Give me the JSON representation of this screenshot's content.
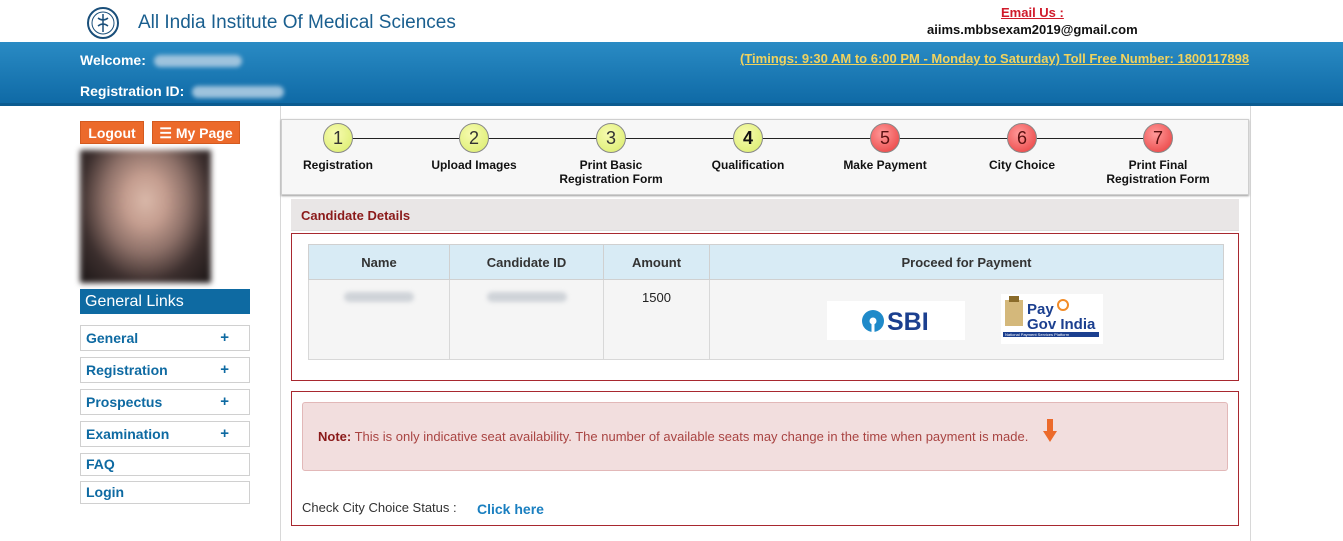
{
  "header": {
    "title": "All India Institute Of Medical Sciences",
    "email_label": "Email Us :",
    "email_value": "aiims.mbbsexam2019@gmail.com",
    "welcome_label": "Welcome:",
    "registration_label": "Registration ID:",
    "timings": "(Timings: 9:30 AM to 6:00 PM - Monday to Saturday) Toll Free Number: 1800117898"
  },
  "sidebar": {
    "logout_label": "Logout",
    "mypage_label": "My Page",
    "general_links_title": "General Links",
    "items": [
      {
        "label": "General",
        "expand": "+"
      },
      {
        "label": "Registration",
        "expand": "+"
      },
      {
        "label": "Prospectus",
        "expand": "+"
      },
      {
        "label": "Examination",
        "expand": "+"
      },
      {
        "label": "FAQ"
      },
      {
        "label": "Login"
      }
    ]
  },
  "steps": [
    {
      "number": "1",
      "label": "Registration",
      "status": "done"
    },
    {
      "number": "2",
      "label": "Upload Images",
      "status": "done"
    },
    {
      "number": "3",
      "label": "Print Basic Registration Form",
      "status": "done"
    },
    {
      "number": "4",
      "label": "Qualification",
      "status": "current"
    },
    {
      "number": "5",
      "label": "Make Payment",
      "status": "pending"
    },
    {
      "number": "6",
      "label": "City Choice",
      "status": "pending"
    },
    {
      "number": "7",
      "label": "Print Final Registration Form",
      "status": "pending"
    }
  ],
  "candidate": {
    "section_title": "Candidate Details",
    "columns": [
      "Name",
      "Candidate ID",
      "Amount",
      "Proceed for Payment"
    ],
    "amount": "1500",
    "sbi_label": "SBI",
    "paygov_line1": "Pay",
    "paygov_line2": "Gov India",
    "paygov_sub": "National Payment Services Platform"
  },
  "note": {
    "prefix": "Note:",
    "text": "This is only indicative seat availability. The number of available seats may change in the time when payment is made."
  },
  "city_status": {
    "label": "Check City Choice Status :",
    "link": "Click here"
  },
  "colors": {
    "brand_blue": "#0e6aa2",
    "accent_orange": "#ec6a2b",
    "panel_border": "#a8282f"
  }
}
